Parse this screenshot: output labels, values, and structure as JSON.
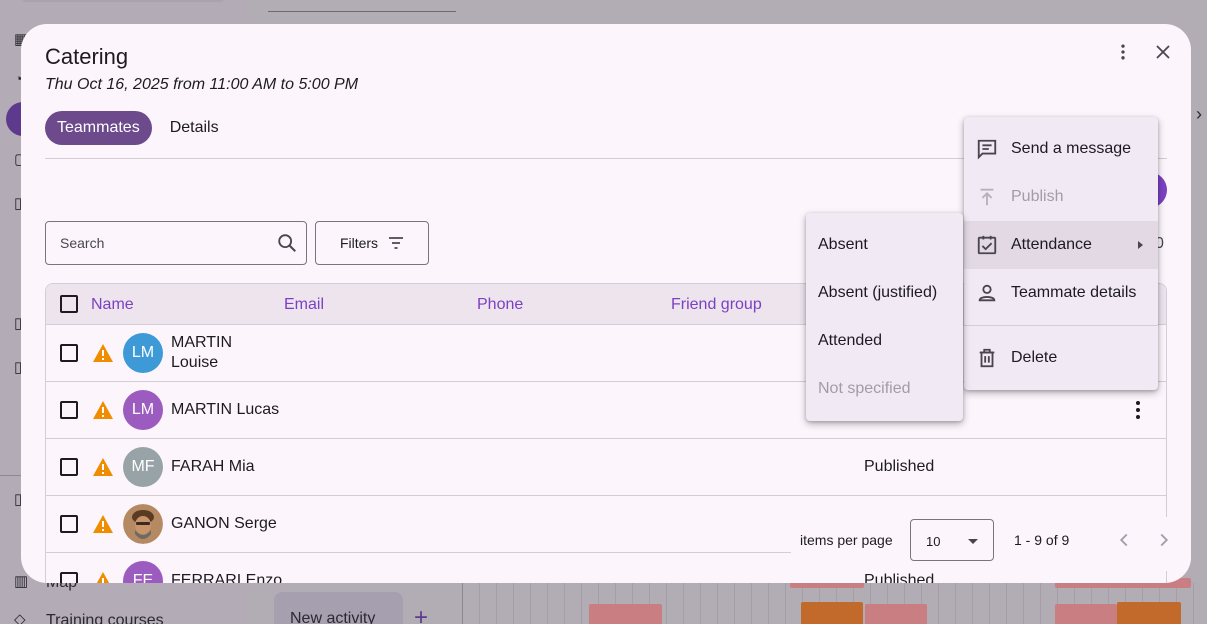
{
  "background": {
    "sidebar": {
      "labels": [
        "Map",
        "Training courses"
      ]
    },
    "new_activity_label": "New activity",
    "plus_glyph": "+",
    "colors": {
      "event_red": "#e08a8a",
      "event_orange": "#d6682a",
      "event_teal": "#3a9b9b",
      "selected_nav": "#5e3a8c"
    }
  },
  "dialog": {
    "title": "Catering",
    "subtitle": "Thu Oct 16, 2025 from 11:00 AM to 5:00 PM",
    "more_icon": "more-vert-icon",
    "close_icon": "close-icon",
    "tabs": [
      {
        "label": "Teammates",
        "active": true
      },
      {
        "label": "Details",
        "active": false
      }
    ],
    "search": {
      "placeholder": "Search",
      "value": "",
      "icon": "search-icon"
    },
    "filters": {
      "label": "Filters",
      "icon": "filter-list-icon"
    },
    "count_peek": "0",
    "table": {
      "columns": [
        "Name",
        "Email",
        "Phone",
        "Friend group"
      ],
      "rows": [
        {
          "initials": "LM",
          "name_line1": "MARTIN",
          "name_line2": "Louise",
          "avatar_color": "#3d9ad6",
          "status": ""
        },
        {
          "initials": "LM",
          "name_line1": "MARTIN Lucas",
          "name_line2": "",
          "avatar_color": "#9c5bbf",
          "status": ""
        },
        {
          "initials": "MF",
          "name_line1": "FARAH Mia",
          "name_line2": "",
          "avatar_color": "#97a3a6",
          "status": "Published"
        },
        {
          "initials": "",
          "name_line1": "GANON Serge",
          "name_line2": "",
          "avatar_color": "#8a6a4a",
          "status": ""
        },
        {
          "initials": "FE",
          "name_line1": "FERRARI Enzo",
          "name_line2": "",
          "avatar_color": "#9c5bbf",
          "status": "Published"
        }
      ]
    },
    "paginator": {
      "items_per_page_label": "items per page",
      "page_size": "10",
      "range_label": "1 - 9 of 9",
      "prev_icon": "chevron-left-icon",
      "next_icon": "chevron-right-icon"
    }
  },
  "context_menu": {
    "items": [
      {
        "label": "Send a message",
        "icon": "message-icon",
        "disabled": false
      },
      {
        "label": "Publish",
        "icon": "publish-icon",
        "disabled": true
      },
      {
        "label": "Attendance",
        "icon": "checkbox-icon",
        "disabled": false,
        "has_submenu": true
      },
      {
        "label": "Teammate details",
        "icon": "person-icon",
        "disabled": false
      },
      {
        "label": "Delete",
        "icon": "trash-icon",
        "disabled": false
      }
    ]
  },
  "attendance_submenu": {
    "items": [
      {
        "label": "Absent",
        "disabled": false
      },
      {
        "label": "Absent (justified)",
        "disabled": false
      },
      {
        "label": "Attended",
        "disabled": false
      },
      {
        "label": "Not specified",
        "disabled": true
      }
    ]
  },
  "colors": {
    "accent": "#7b41c2",
    "tab_active": "#6c4a8c",
    "warning": "#f08c00",
    "dialog_bg": "#fcf6fc",
    "menu_bg": "#f1e9f3"
  }
}
